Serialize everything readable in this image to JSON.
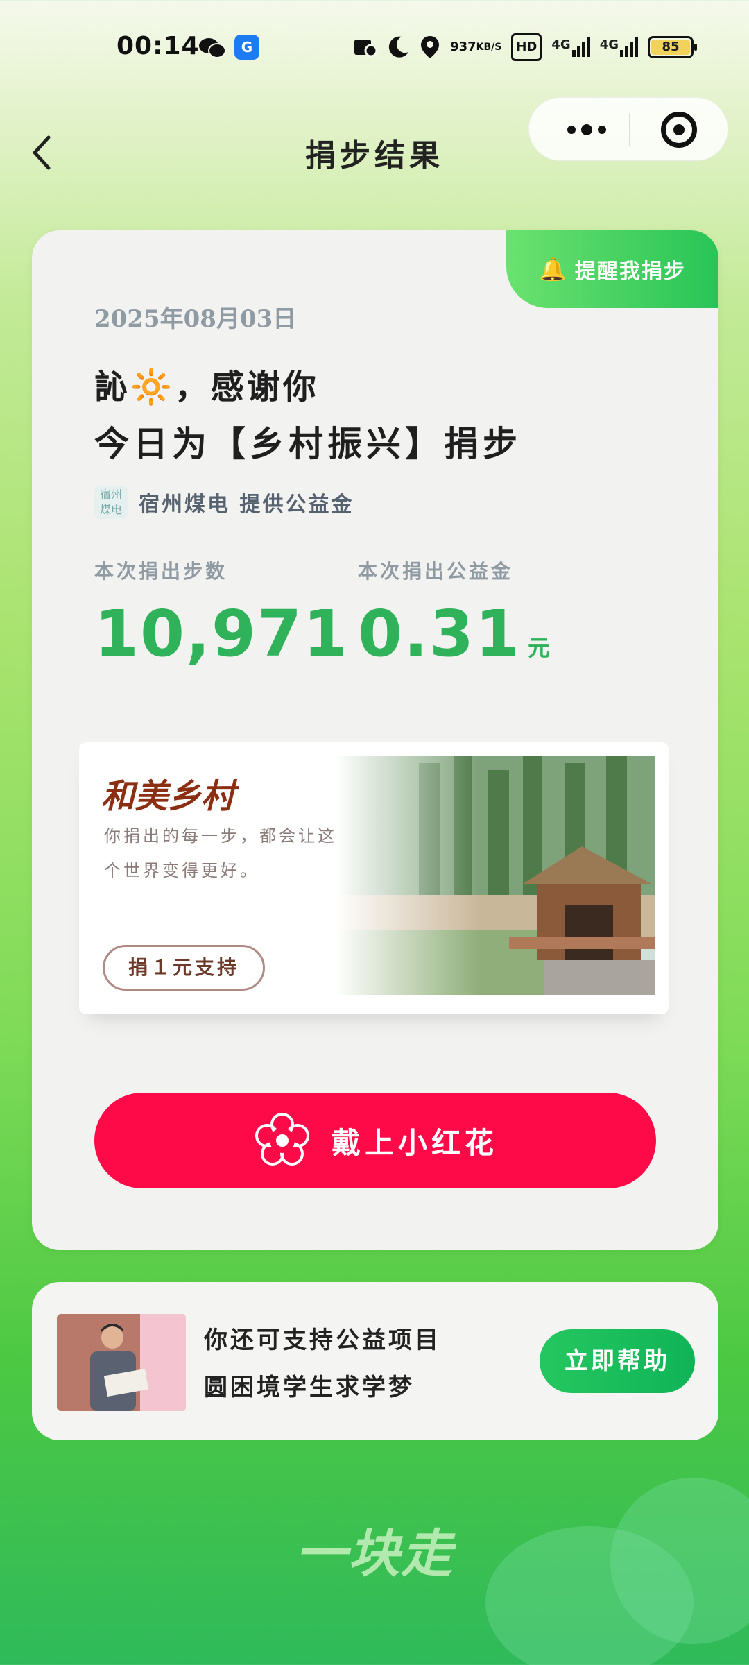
{
  "status_bar": {
    "time": "00:14",
    "app_badge": "G",
    "net_speed_top": "937",
    "net_speed_bottom": "KB/S",
    "hd": "HD",
    "signal1": "4G",
    "signal2": "4G",
    "battery": "85"
  },
  "nav": {
    "title": "捐步结果"
  },
  "card": {
    "remind_label": "提醒我捐步",
    "date": "2025年08月03日",
    "greeting": "訫🔆，感谢你",
    "thanks": "今日为【乡村振兴】捐步",
    "sponsor_logo_line1": "宿州",
    "sponsor_logo_line2": "煤电",
    "sponsor_text": "宿州煤电 提供公益金",
    "steps_label": "本次捐出步数",
    "steps_value": "10,971",
    "money_label": "本次捐出公益金",
    "money_value": "0.31",
    "money_unit": "元"
  },
  "project": {
    "title": "和美乡村",
    "desc": "你捐出的每一步，都会让这个世界变得更好。",
    "button": "捐１元支持"
  },
  "flower_button": "戴上小红花",
  "bottom": {
    "line1": "你还可支持公益项目",
    "line2": "圆困境学生求学梦",
    "button": "立即帮助"
  },
  "slogan": "一块走",
  "colors": {
    "accent_green": "#2fb25a",
    "red": "#ff0a48"
  }
}
